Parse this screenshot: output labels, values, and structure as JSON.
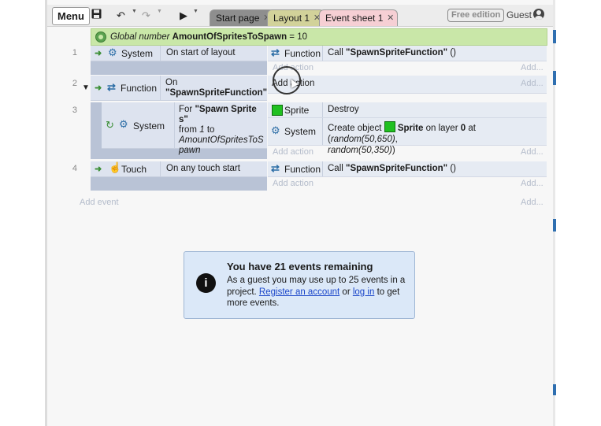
{
  "toolbar": {
    "menu": "Menu",
    "tabs": [
      {
        "label": "Start page"
      },
      {
        "label": "Layout 1"
      },
      {
        "label": "Event sheet 1"
      }
    ],
    "badge": "Free edition",
    "user": "Guest"
  },
  "sheet": {
    "global_var": {
      "prefix": "Global number",
      "name": "AmountOfSpritesToSpawn",
      "value": "= 10"
    },
    "events": [
      {
        "number": "1",
        "condition": {
          "object": "System",
          "text": "On start of layout"
        },
        "actions": [
          {
            "object": "Function",
            "text_prefix": "Call",
            "text_bold": "\"SpawnSpriteFunction\"",
            "text_suffix": "()"
          }
        ],
        "add_action": "Add action",
        "add_action_right": "Add..."
      },
      {
        "number": "2",
        "condition": {
          "object": "Function",
          "text_prefix": "On",
          "text_bold": "\"SpawnSpriteFunction\""
        },
        "add_action": "Add action",
        "add_action_right": "Add..."
      },
      {
        "number": "3",
        "condition": {
          "object": "System",
          "text_prefix": "For",
          "text_bold": "\"Spawn Sprites\"",
          "text_mid": "from",
          "text_from": "1",
          "text_to": "to",
          "text_italic": "AmountOfSpritesToSpawn"
        },
        "actions": [
          {
            "object": "Sprite",
            "text": "Destroy"
          },
          {
            "object": "System",
            "text_prefix": "Create object",
            "text_obj": "Sprite",
            "text_layer": "on layer",
            "layer": "0",
            "text_at": "at (",
            "expr": "random(50,650)",
            "text_comma": ",",
            "expr2": "random(50,350)",
            "text_end": ")"
          }
        ],
        "add_action": "Add action",
        "add_action_right": "Add..."
      },
      {
        "number": "4",
        "condition": {
          "object": "Touch",
          "text": "On any touch start"
        },
        "actions": [
          {
            "object": "Function",
            "text_prefix": "Call",
            "text_bold": "\"SpawnSpriteFunction\"",
            "text_suffix": "()"
          }
        ],
        "add_action": "Add action",
        "add_action_right": "Add..."
      }
    ],
    "add_event": "Add event",
    "add_event_right": "Add..."
  },
  "notice": {
    "title": "You have 21 events remaining",
    "body_1": "As a guest you may use up to 25 events in a project.",
    "link_register": "Register an account",
    "body_or": "or",
    "link_login": "log in",
    "body_2": "to get more events."
  },
  "colors": {
    "global_var_bg": "#c9e7a8",
    "event_bar": "#b9c3d6",
    "condition_row": "#dde3ef",
    "sprite_green": "#20c020",
    "link_blue": "#1b46c9",
    "info_bg": "#dbe8f8"
  }
}
